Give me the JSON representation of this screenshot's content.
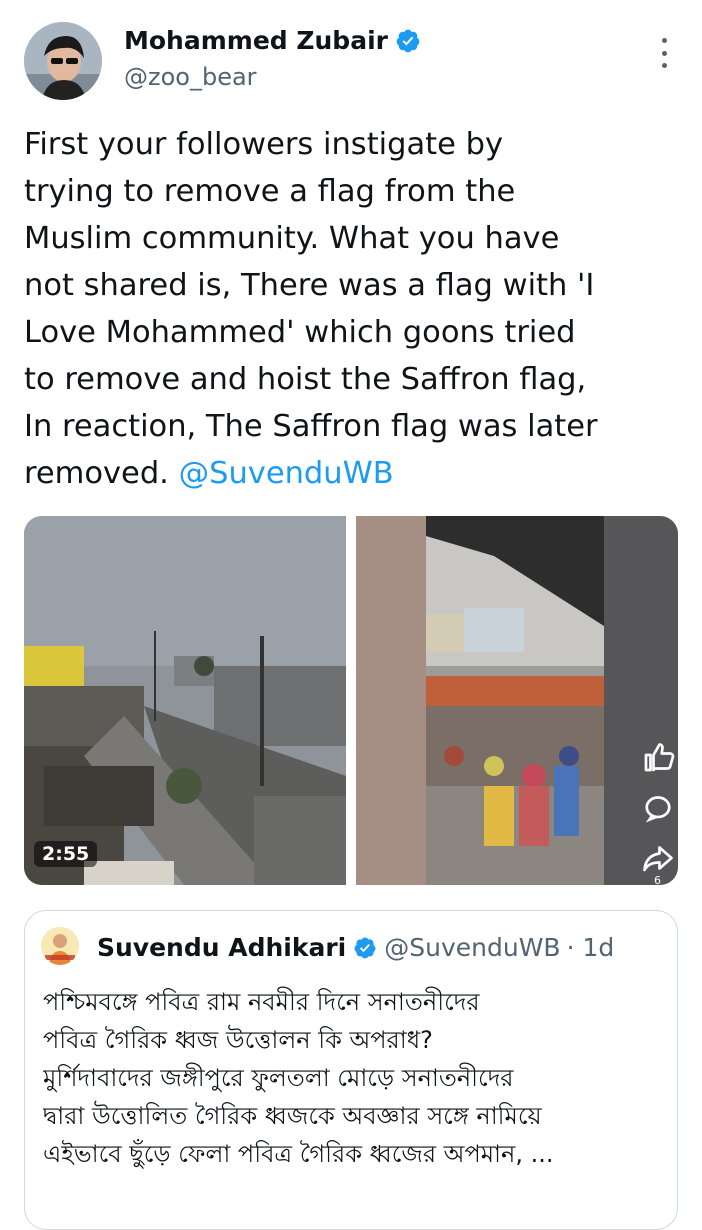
{
  "author": {
    "name": "Mohammed Zubair",
    "handle": "@zoo_bear"
  },
  "tweet": {
    "lines": [
      "First your followers instigate by",
      "trying to remove a flag from the",
      "Muslim community. What you have",
      "not shared is, There was a flag with 'I",
      "Love Mohammed' which goons tried",
      "to remove and hoist the Saffron flag,",
      "In reaction, The Saffron flag was later",
      "removed. "
    ],
    "mention": "@SuvenduWB"
  },
  "media": {
    "video_duration": "2:55",
    "share_count": "6"
  },
  "quoted_tweet": {
    "name": "Suvendu Adhikari",
    "handle": "@SuvenduWB",
    "time": "· 1d",
    "lines": [
      "পশ্চিমবঙ্গে পবিত্র রাম নবমীর দিনে সনাতনীদের",
      "পবিত্র গৈরিক ধ্বজ উত্তোলন কি অপরাধ?",
      "মুর্শিদাবাদের জঙ্গীপুরে ফুলতলা মোড়ে  সনাতনীদের",
      "দ্বারা উত্তোলিত গৈরিক ধ্বজকে অবজ্ঞার সঙ্গে নামিয়ে",
      "এইভাবে ছুঁড়ে ফেলা পবিত্র গৈরিক ধ্বজের অপমান, ..."
    ]
  },
  "icons": {
    "verified": "verified-badge-icon",
    "more": "more-options-icon",
    "like": "like-icon",
    "reply": "reply-icon",
    "share": "share-icon"
  },
  "colors": {
    "link": "#1d9bf0",
    "verified": "#1d9bf0",
    "secondary_text": "#536471",
    "border": "#cfd9de"
  }
}
